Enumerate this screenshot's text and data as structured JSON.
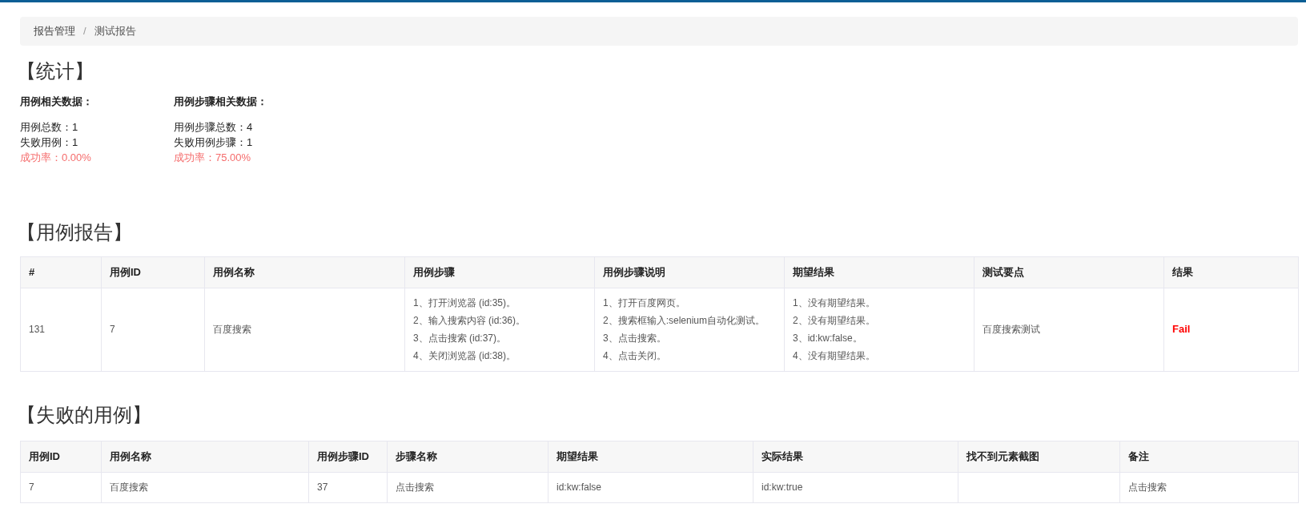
{
  "breadcrumb": [
    {
      "label": "报告管理",
      "selected": false
    },
    {
      "label": "/",
      "kind": "separator"
    },
    {
      "label": "测试报告",
      "selected": true
    }
  ],
  "statistics": {
    "title": "【统计】",
    "groups": [
      {
        "title": "用例相关数据：",
        "items": [
          {
            "kind": "plain",
            "text": "用例总数：1"
          },
          {
            "kind": "plain",
            "text": "失败用例：1"
          },
          {
            "kind": "rate",
            "text": "成功率：0.00%"
          }
        ]
      },
      {
        "title": "用例步骤相关数据：",
        "items": [
          {
            "kind": "plain",
            "text": "用例步骤总数：4"
          },
          {
            "kind": "plain",
            "text": "失败用例步骤：1"
          },
          {
            "kind": "rate",
            "text": "成功率：75.00%"
          }
        ]
      }
    ]
  },
  "case_report": {
    "title": "【用例报告】",
    "columns": [
      "#",
      "用例ID",
      "用例名称",
      "用例步骤",
      "用例步骤说明",
      "期望结果",
      "测试要点",
      "结果"
    ],
    "rows": [
      {
        "cells": [
          "131",
          "7",
          "百度搜索",
          [
            "1、打开浏览器 (id:35)。",
            "2、输入搜索内容 (id:36)。",
            "3、点击搜索 (id:37)。",
            "4、关闭浏览器 (id:38)。"
          ],
          [
            "1、打开百度网页。",
            "2、搜索框输入:selenium自动化测试。",
            "3、点击搜索。",
            "4、点击关闭。"
          ],
          [
            "1、没有期望结果。",
            "2、没有期望结果。",
            "3、id:kw:false。",
            "4、没有期望结果。"
          ],
          "百度搜索测试",
          "Fail"
        ]
      }
    ]
  },
  "failed_cases": {
    "title": "【失败的用例】",
    "columns": [
      "用例ID",
      "用例名称",
      "用例步骤ID",
      "步骤名称",
      "期望结果",
      "实际结果",
      "找不到元素截图",
      "备注"
    ],
    "rows": [
      {
        "cells": [
          "7",
          "百度搜索",
          "37",
          "点击搜索",
          "id:kw:false",
          "id:kw:true",
          "",
          "点击搜索"
        ]
      }
    ]
  }
}
